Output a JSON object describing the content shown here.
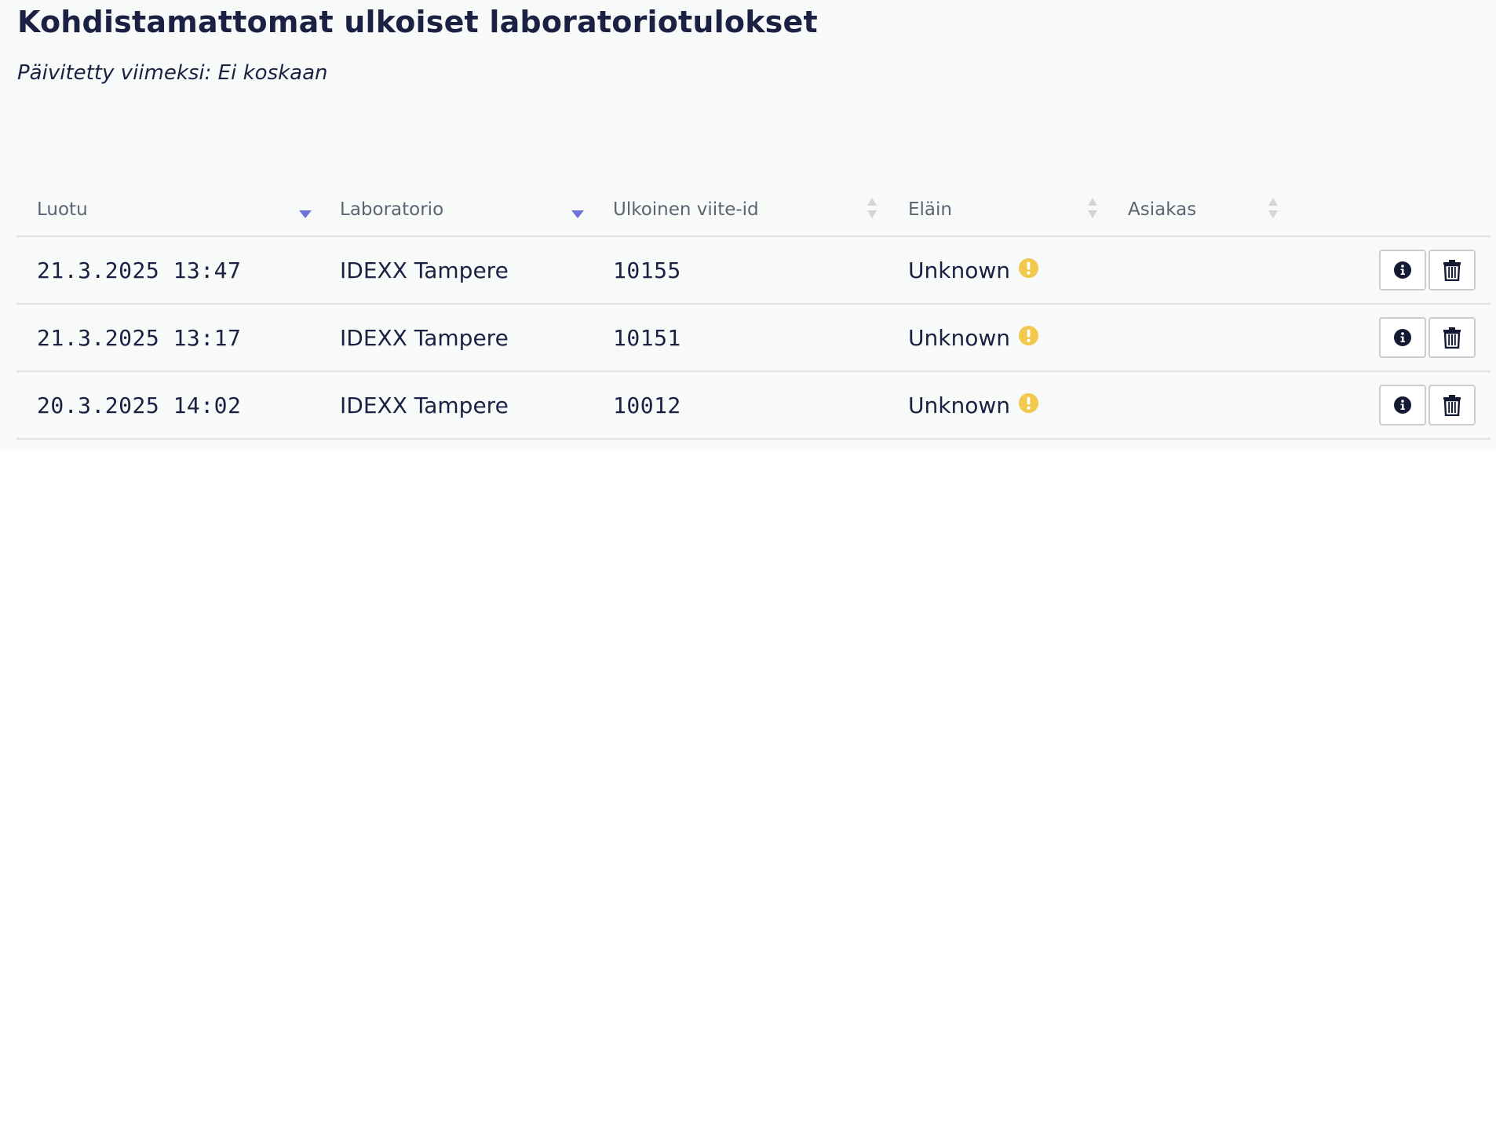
{
  "page": {
    "title": "Kohdistamattomat ulkoiset laboratoriotulokset",
    "updated": "Päivitetty viimeksi: Ei koskaan"
  },
  "table": {
    "columns": [
      {
        "label": "Luotu",
        "sort": "desc-active"
      },
      {
        "label": "Laboratorio",
        "sort": "desc-active"
      },
      {
        "label": "Ulkoinen viite-id",
        "sort": "none"
      },
      {
        "label": "Eläin",
        "sort": "none"
      },
      {
        "label": "Asiakas",
        "sort": "none"
      }
    ],
    "rows": [
      {
        "created": "21.3.2025 13:47",
        "lab": "IDEXX Tampere",
        "ref": "10155",
        "animal": "Unknown",
        "customer": ""
      },
      {
        "created": "21.3.2025 13:17",
        "lab": "IDEXX Tampere",
        "ref": "10151",
        "animal": "Unknown",
        "customer": ""
      },
      {
        "created": "20.3.2025 14:02",
        "lab": "IDEXX Tampere",
        "ref": "10012",
        "animal": "Unknown",
        "customer": ""
      }
    ],
    "row_actions": {
      "info_icon": "info-icon",
      "delete_icon": "trash-icon"
    }
  },
  "colors": {
    "sort_active": "#6f72d9",
    "sort_inactive": "#d3d5d9",
    "warning": "#f2c94c",
    "text": "#1a2142",
    "header_text": "#5d6370"
  }
}
